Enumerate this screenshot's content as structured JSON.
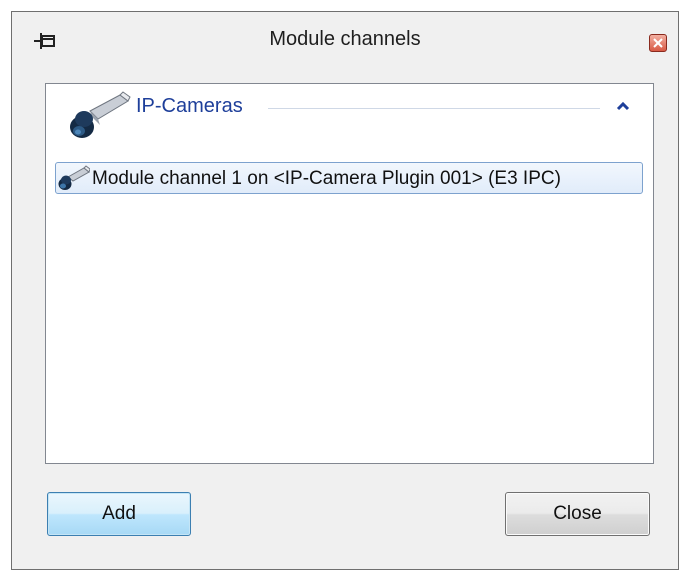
{
  "window": {
    "title": "Module channels",
    "icons": {
      "pin": "pin-icon",
      "close": "close-icon"
    }
  },
  "channel_list": {
    "group": {
      "label": "IP-Cameras",
      "icon": "ip-camera-icon",
      "collapse_icon": "chevron-up-icon"
    },
    "items": [
      {
        "label": "Module channel 1 on <IP-Camera Plugin 001> (E3 IPC)",
        "icon": "ip-camera-icon",
        "selected": true
      }
    ]
  },
  "buttons": {
    "add_label": "Add",
    "close_label": "Close"
  },
  "colors": {
    "group_label": "#1e3f9a",
    "selection_border": "#7da2ce",
    "selection_fill": "#e1ecfa",
    "add_button_border": "#3c7fb1",
    "close_box": "#d85a45"
  }
}
